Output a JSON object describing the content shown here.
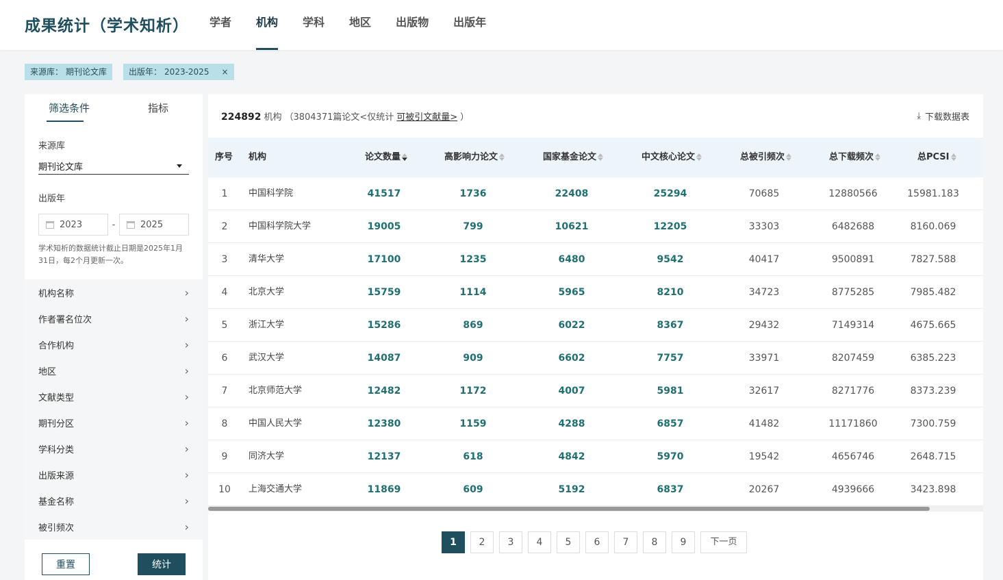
{
  "app": {
    "title": "成果统计（学术知析）"
  },
  "nav": {
    "tabs": [
      "学者",
      "机构",
      "学科",
      "地区",
      "出版物",
      "出版年"
    ],
    "active": "机构"
  },
  "chips": [
    {
      "label": "来源库：",
      "value": "期刊论文库"
    },
    {
      "label": "出版年：",
      "value": "2023-2025",
      "close": "×"
    }
  ],
  "sidebar": {
    "tabs": [
      "筛选条件",
      "指标"
    ],
    "source_label": "来源库",
    "source_value": "期刊论文库",
    "year_label": "出版年",
    "year_from": "2023",
    "year_sep": "-",
    "year_to": "2025",
    "note": "学术知析的数据统计截止日期是2025年1月31日，每2个月更新一次。",
    "filters": [
      "机构名称",
      "作者署名位次",
      "合作机构",
      "地区",
      "文献类型",
      "期刊分区",
      "学科分类",
      "出版来源",
      "基金名称",
      "被引频次"
    ],
    "reset_label": "重置",
    "stat_label": "统计"
  },
  "summary": {
    "count": "224892",
    "unit": "机构",
    "detail_prefix": "（3804371篇论文<仅统计",
    "detail_link": "可被引文献量>",
    "detail_suffix": "）",
    "download_label": "下载数据表",
    "download_icon": "download-icon"
  },
  "table": {
    "headers": [
      "序号",
      "机构",
      "论文数量",
      "高影响力论文",
      "国家基金论文",
      "中文核心论文",
      "总被引频次",
      "总下载频次",
      "总PCSI"
    ],
    "rows": [
      [
        "1",
        "中国科学院",
        "41517",
        "1736",
        "22408",
        "25294",
        "70685",
        "12880566",
        "15981.183"
      ],
      [
        "2",
        "中国科学院大学",
        "19005",
        "799",
        "10621",
        "12205",
        "33303",
        "6482688",
        "8160.069"
      ],
      [
        "3",
        "清华大学",
        "17100",
        "1235",
        "6480",
        "9542",
        "40417",
        "9500891",
        "7827.588"
      ],
      [
        "4",
        "北京大学",
        "15759",
        "1114",
        "5965",
        "8210",
        "34723",
        "8775285",
        "7985.482"
      ],
      [
        "5",
        "浙江大学",
        "15286",
        "869",
        "6022",
        "8367",
        "29432",
        "7149314",
        "4675.665"
      ],
      [
        "6",
        "武汉大学",
        "14087",
        "909",
        "6602",
        "7757",
        "33971",
        "8207459",
        "6385.223"
      ],
      [
        "7",
        "北京师范大学",
        "12482",
        "1172",
        "4007",
        "5981",
        "32617",
        "8271776",
        "8373.239"
      ],
      [
        "8",
        "中国人民大学",
        "12380",
        "1159",
        "4288",
        "6857",
        "41482",
        "11171860",
        "7300.759"
      ],
      [
        "9",
        "同济大学",
        "12137",
        "618",
        "4842",
        "5970",
        "19542",
        "4656746",
        "2648.715"
      ],
      [
        "10",
        "上海交通大学",
        "11869",
        "609",
        "5192",
        "6837",
        "20267",
        "4939666",
        "3423.898"
      ]
    ]
  },
  "pager": {
    "pages": [
      "1",
      "2",
      "3",
      "4",
      "5",
      "6",
      "7",
      "8",
      "9"
    ],
    "active": "1",
    "next_label": "下一页"
  },
  "colors": {
    "primary": "#1f4e5f",
    "number": "#1f6f73",
    "chip": "#b9dfe8",
    "header_bg": "#eef5fa"
  }
}
